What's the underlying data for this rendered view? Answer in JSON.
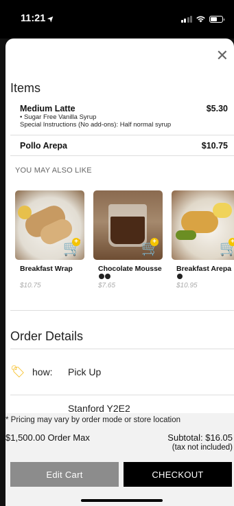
{
  "status_bar": {
    "time": "11:21",
    "location_glyph": "➤",
    "signal_icon": "cellular-signal-icon",
    "wifi_icon": "wifi-icon",
    "battery_icon": "battery-icon"
  },
  "close_icon": "close-icon",
  "items": {
    "heading": "Items",
    "list": [
      {
        "name": "Medium Latte",
        "price": "$5.30",
        "modifiers": [
          "• Sugar Free Vanilla Syrup",
          "Special Instructions (No add-ons): Half normal syrup"
        ]
      },
      {
        "name": "Pollo Arepa",
        "price": "$10.75",
        "modifiers": []
      }
    ]
  },
  "recommendations": {
    "heading": "YOU MAY ALSO LIKE",
    "list": [
      {
        "name": "Breakfast Wrap",
        "price": "$10.75"
      },
      {
        "name": "Chocolate Mousse",
        "price": "$7.65",
        "badges": [
          "vegan",
          "gluten-free"
        ]
      },
      {
        "name": "Breakfast Arepa",
        "price": "$10.95",
        "badges": [
          "gluten-free"
        ]
      }
    ],
    "add_to_cart_icon": "add-to-cart-icon"
  },
  "order_details": {
    "heading": "Order Details",
    "how_label": "how:",
    "how_value": "Pick Up",
    "where_value": "Stanford Y2E2",
    "tag_icon": "tag-icon"
  },
  "footer": {
    "note": "* Pricing may vary by order mode or store location",
    "max": "$1,500.00 Order Max",
    "subtotal": "Subtotal: $16.05",
    "tax_note": "(tax not included)",
    "edit_cart": "Edit Cart",
    "checkout": "CHECKOUT"
  },
  "colors": {
    "accent": "#f5c400",
    "checkout_bg": "#000000",
    "edit_bg": "#8c8c8c"
  }
}
